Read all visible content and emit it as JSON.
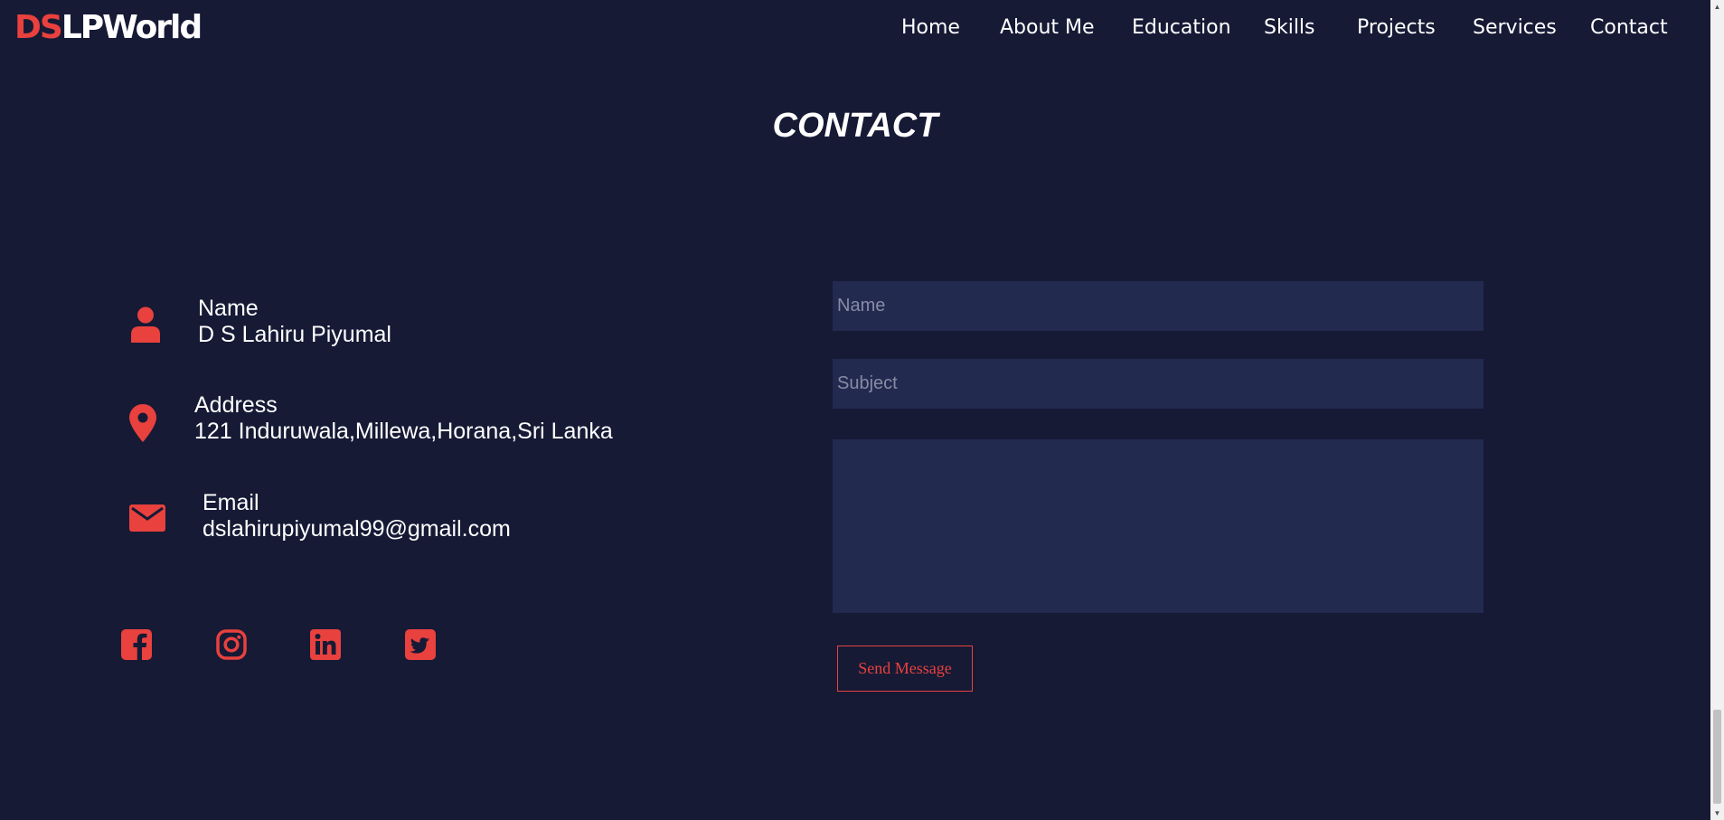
{
  "header": {
    "logo_accent": "DS",
    "logo_main": "LPWorld",
    "nav": [
      "Home",
      "About Me",
      "Education",
      "Skills",
      "Projects",
      "Services",
      "Contact"
    ]
  },
  "contact": {
    "title": "CONTACT",
    "name_label": "Name",
    "name_value": "D S Lahiru Piyumal",
    "address_label": "Address",
    "address_value": "121 Induruwala,Millewa,Horana,Sri Lanka",
    "email_label": "Email",
    "email_value": "dslahirupiyumal99@gmail.com",
    "social_icons": [
      "facebook-icon",
      "instagram-icon",
      "linkedin-icon",
      "twitter-icon"
    ]
  },
  "form": {
    "name_placeholder": "Name",
    "subject_placeholder": "Subject",
    "send_label": "Send Message"
  },
  "colors": {
    "background": "#161a35",
    "accent": "#e8413e",
    "field_background": "#222a50"
  }
}
